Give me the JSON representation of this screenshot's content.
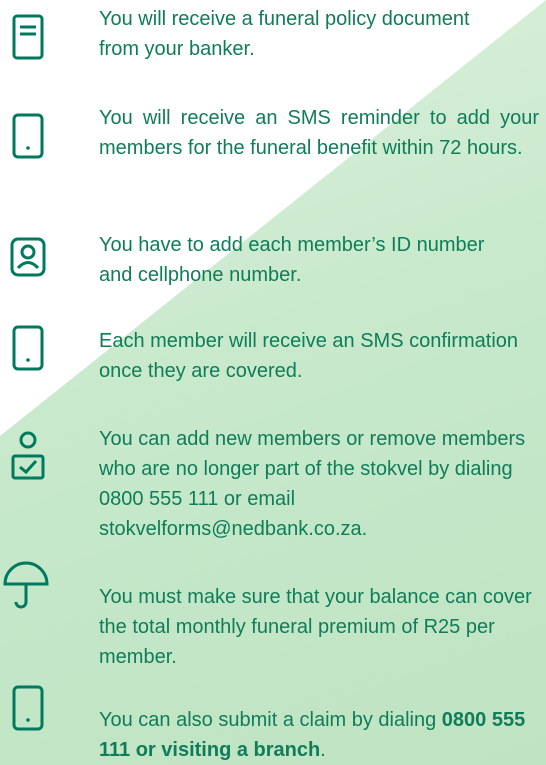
{
  "steps": [
    {
      "icon": "document-icon",
      "text": "You will receive a funeral policy document from your banker."
    },
    {
      "icon": "phone-icon",
      "text": "You will receive an SMS reminder to add your members for the funeral benefit within 72 hours."
    },
    {
      "icon": "id-card-icon",
      "text": "You have to add each member’s ID number and cellphone number."
    },
    {
      "icon": "phone-icon",
      "text": "Each member will receive an SMS confirmation once they are covered."
    },
    {
      "icon": "person-check-icon",
      "text": "You can add new members or remove members who are no longer part of the stokvel by dialing  0800 555 111 or email stokvelforms@nedbank.co.za."
    },
    {
      "icon": "umbrella-icon",
      "text": "You must make sure that your balance can cover the total monthly funeral premium of R25 per member."
    },
    {
      "icon": "phone-icon",
      "text_plain": "You can also submit a claim by dialing",
      "text_bold": "0800 555 111 or visiting a branch",
      "text_end": "."
    }
  ],
  "colors": {
    "text": "#0f7d58",
    "icon": "#007a5e",
    "green_bg": "#c8e9cc"
  }
}
